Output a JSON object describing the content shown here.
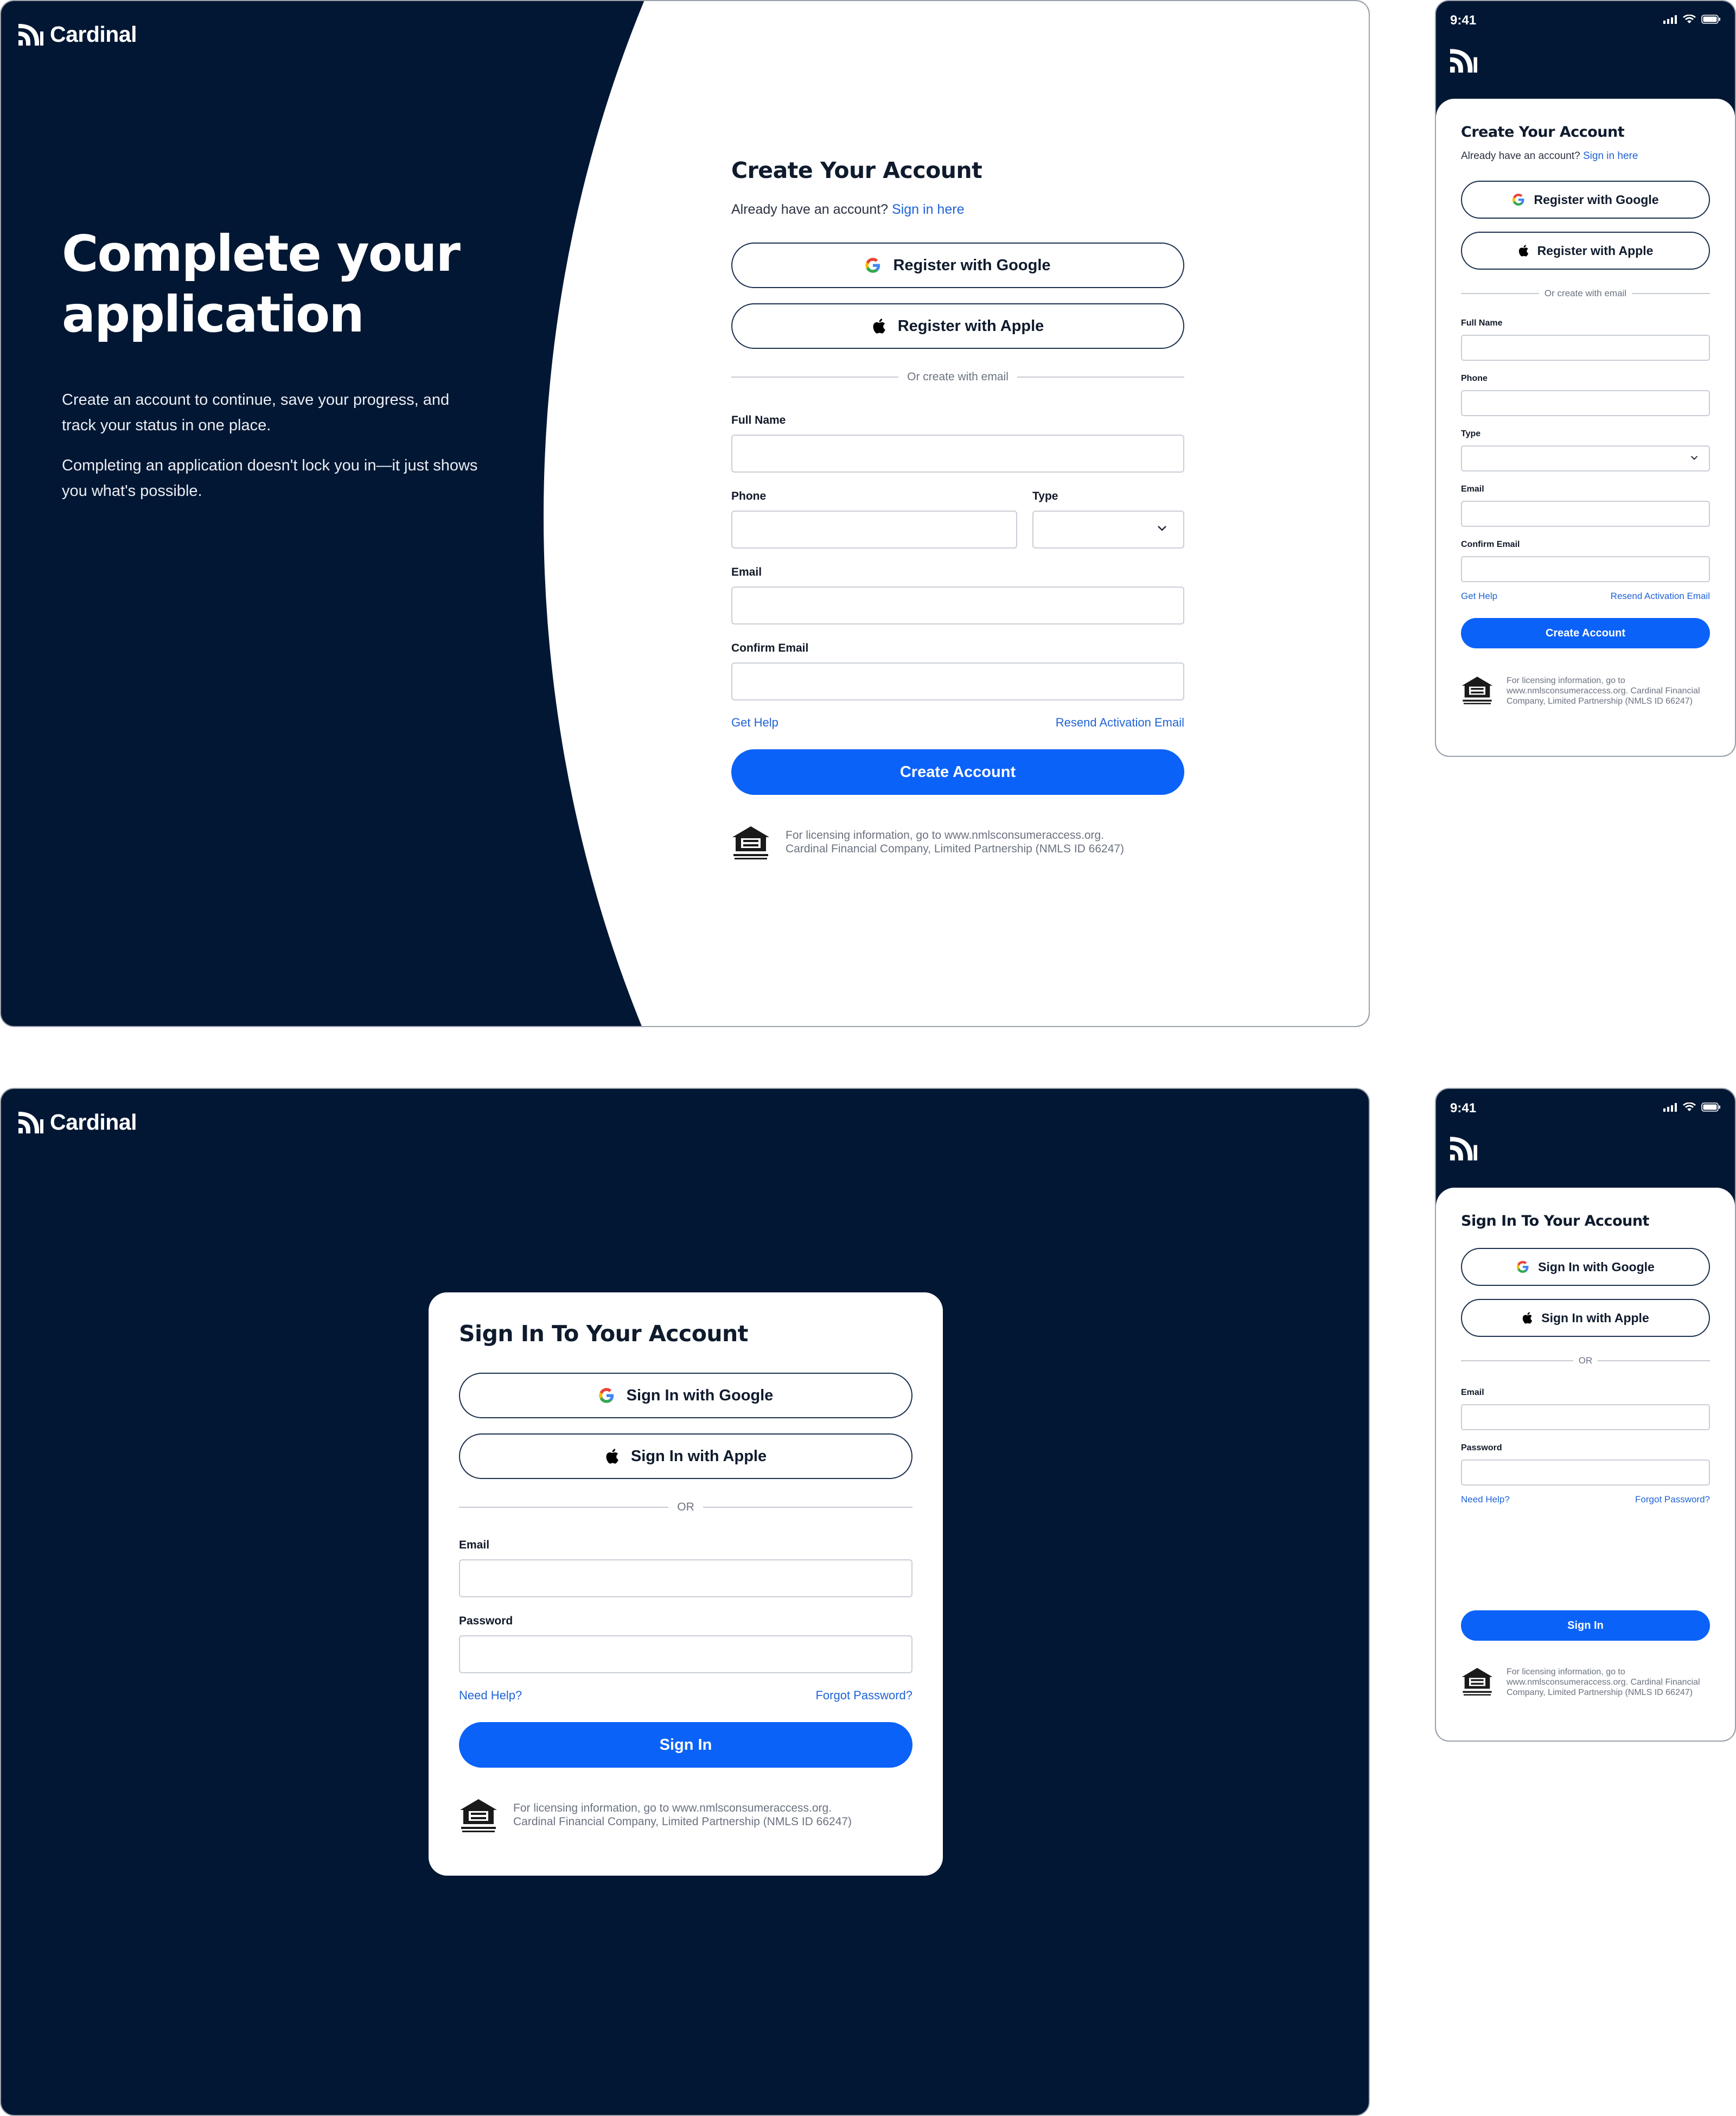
{
  "brand": {
    "name": "Cardinal"
  },
  "colors": {
    "navy": "#021733",
    "primary": "#0b62f8",
    "link": "#1f63d6"
  },
  "icons": {
    "logo": "cardinal-logo-icon",
    "google": "google-g-icon",
    "apple": "apple-icon",
    "chevron": "chevron-down-icon",
    "ehl": "equal-housing-lender-icon",
    "signal": "cellular-signal-icon",
    "wifi": "wifi-icon",
    "battery": "battery-icon"
  },
  "register": {
    "hero_title": "Complete your application",
    "hero_p1": "Create an account to continue, save your progress, and track your status in one place.",
    "hero_p2": "Completing an application doesn't lock you in—it just shows you what's possible.",
    "title": "Create Your Account",
    "already_text": "Already have an account?",
    "signin_link": "Sign in here",
    "google_btn": "Register with Google",
    "apple_btn": "Register with Apple",
    "divider": "Or create with email",
    "full_name": "Full Name",
    "phone": "Phone",
    "type": "Type",
    "email": "Email",
    "confirm_email": "Confirm Email",
    "get_help": "Get Help",
    "resend": "Resend Activation Email",
    "create_btn": "Create Account",
    "footer_desktop_1": "For licensing information, go to www.nmlsconsumeraccess.org.",
    "footer_desktop_2": "Cardinal Financial Company, Limited Partnership (NMLS ID 66247)",
    "footer_mobile": "For licensing information, go to www.nmlsconsumeraccess.org. Cardinal Financial Company, Limited Partnership (NMLS ID 66247)"
  },
  "signin": {
    "title": "Sign In To Your Account",
    "google_btn": "Sign In with Google",
    "apple_btn": "Sign In with Apple",
    "divider": "OR",
    "email": "Email",
    "password": "Password",
    "need_help": "Need Help?",
    "forgot": "Forgot Password?",
    "signin_btn": "Sign In"
  },
  "mobile": {
    "time": "9:41"
  }
}
